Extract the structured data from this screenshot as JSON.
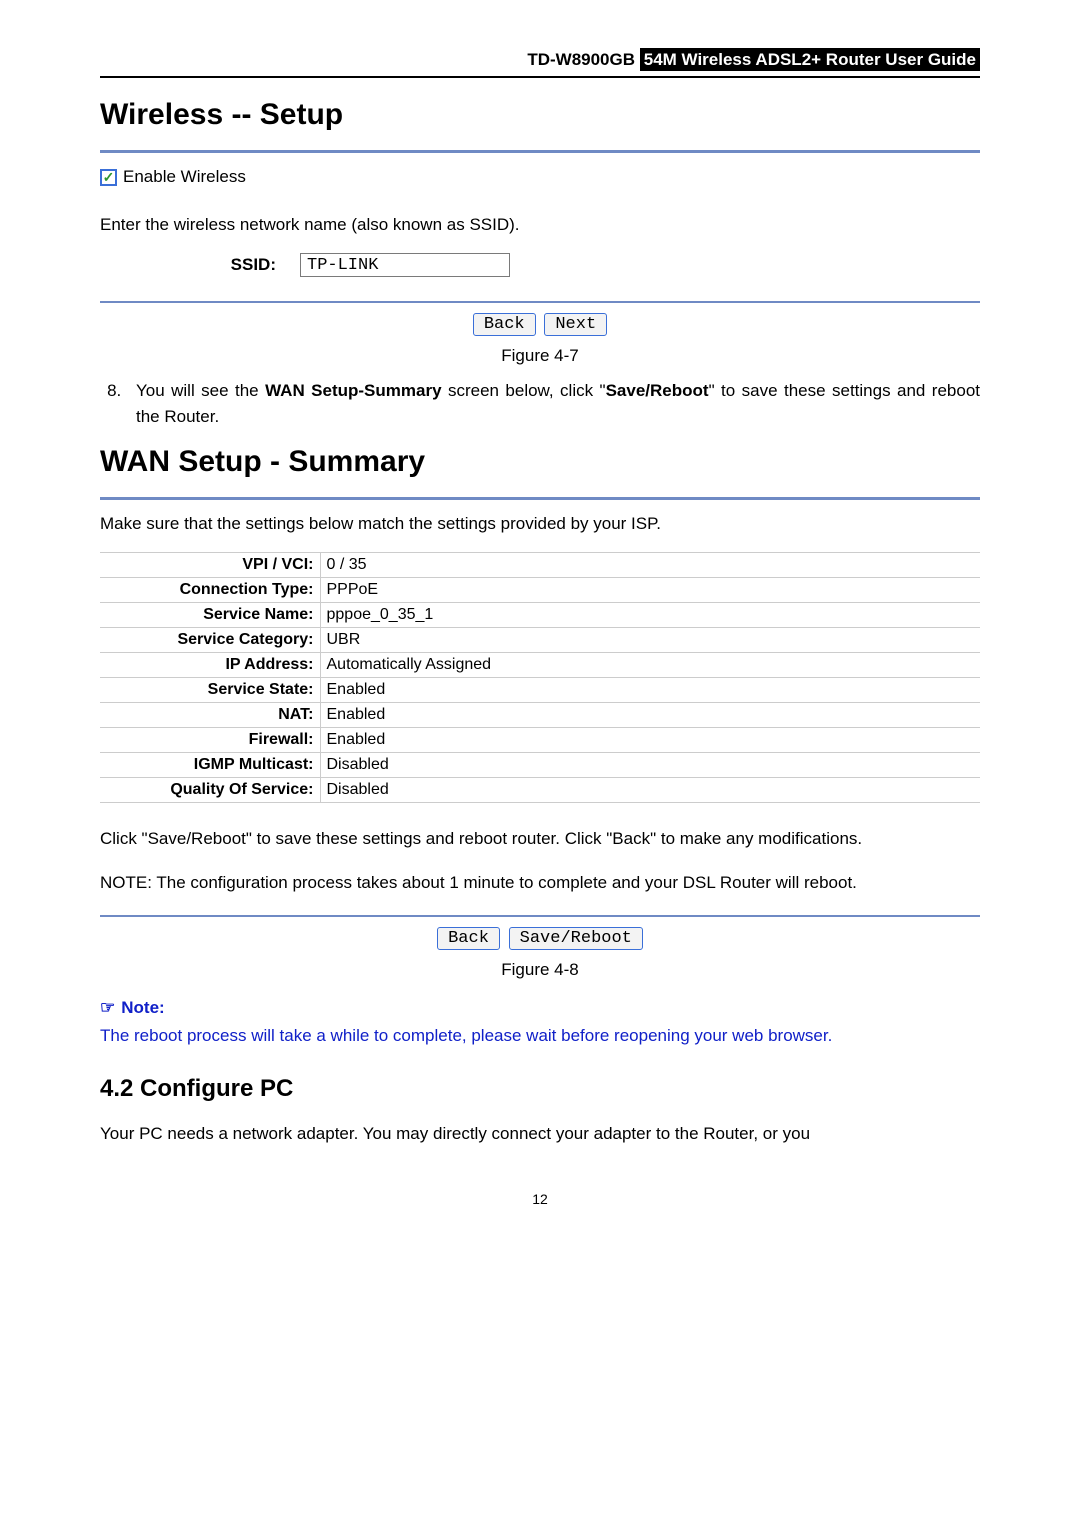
{
  "header": {
    "model": "TD-W8900GB",
    "title": "54M  Wireless  ADSL2+  Router  User  Guide"
  },
  "wireless": {
    "heading": "Wireless -- Setup",
    "enable_label": "Enable Wireless",
    "ssid_instruction": "Enter the wireless network name (also known as SSID).",
    "ssid_label": "SSID:",
    "ssid_value": "TP-LINK",
    "back": "Back",
    "next": "Next",
    "figure": "Figure 4-7"
  },
  "step8": {
    "number": "8.",
    "pre": "You will see the ",
    "b1": "WAN Setup-Summary",
    "mid": " screen below, click \"",
    "b2": "Save/Reboot",
    "post": "\" to save these settings and reboot the Router."
  },
  "summary": {
    "heading": "WAN Setup - Summary",
    "intro": "Make sure that the settings below match the settings provided by your ISP.",
    "rows": [
      {
        "k": "VPI / VCI:",
        "v": "0 / 35"
      },
      {
        "k": "Connection Type:",
        "v": "PPPoE"
      },
      {
        "k": "Service Name:",
        "v": "pppoe_0_35_1"
      },
      {
        "k": "Service Category:",
        "v": "UBR"
      },
      {
        "k": "IP Address:",
        "v": "Automatically Assigned"
      },
      {
        "k": "Service State:",
        "v": "Enabled"
      },
      {
        "k": "NAT:",
        "v": "Enabled"
      },
      {
        "k": "Firewall:",
        "v": "Enabled"
      },
      {
        "k": "IGMP Multicast:",
        "v": "Disabled"
      },
      {
        "k": "Quality Of Service:",
        "v": "Disabled"
      }
    ],
    "instr1": "Click \"Save/Reboot\" to save these settings and reboot router. Click \"Back\" to make any modifications.",
    "instr2": "NOTE: The configuration process takes about 1 minute to complete and your DSL Router will reboot.",
    "back": "Back",
    "save": "Save/Reboot",
    "figure": "Figure 4-8"
  },
  "note": {
    "head": "Note:",
    "body": "The reboot process will take a while to complete, please wait before reopening your web browser."
  },
  "section": {
    "title": "4.2   Configure PC",
    "body": "Your PC needs a network adapter. You may directly connect your adapter to the Router, or you"
  },
  "page_number": "12"
}
